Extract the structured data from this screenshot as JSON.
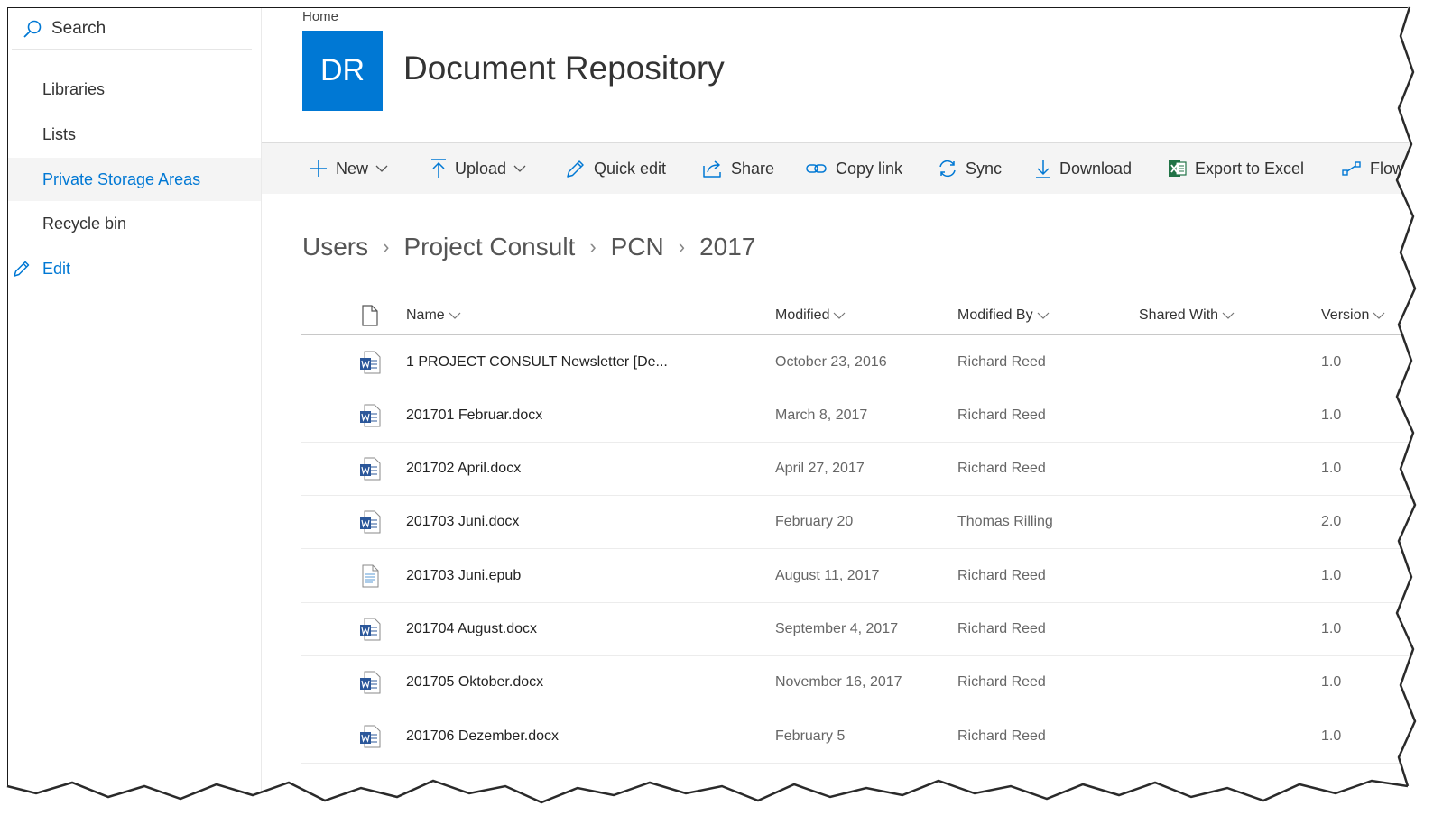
{
  "sidebar": {
    "search_label": "Search",
    "items": [
      {
        "label": "Libraries"
      },
      {
        "label": "Lists"
      },
      {
        "label": "Private Storage Areas"
      },
      {
        "label": "Recycle bin"
      }
    ],
    "edit_label": "Edit",
    "selected_item": "Private Storage Areas"
  },
  "header": {
    "home_link": "Home",
    "site_logo_text": "DR",
    "site_title": "Document Repository"
  },
  "toolbar": {
    "new": "New",
    "upload": "Upload",
    "quick_edit": "Quick edit",
    "share": "Share",
    "copy_link": "Copy link",
    "sync": "Sync",
    "download": "Download",
    "export_excel": "Export to Excel",
    "flow": "Flow"
  },
  "path": [
    "Users",
    "Project Consult",
    "PCN",
    "2017"
  ],
  "table": {
    "columns": {
      "name": "Name",
      "modified": "Modified",
      "modified_by": "Modified By",
      "shared_with": "Shared With",
      "version": "Version"
    },
    "rows": [
      {
        "name": "1 PROJECT CONSULT Newsletter [De...",
        "modified": "October 23, 2016",
        "modified_by": "Richard Reed",
        "version": "1.0",
        "icon": "word-doc-icon"
      },
      {
        "name": "201701 Februar.docx",
        "modified": "March 8, 2017",
        "modified_by": "Richard Reed",
        "version": "1.0",
        "icon": "word-doc-icon"
      },
      {
        "name": "201702 April.docx",
        "modified": "April 27, 2017",
        "modified_by": "Richard Reed",
        "version": "1.0",
        "icon": "word-doc-icon"
      },
      {
        "name": "201703 Juni.docx",
        "modified": "February 20",
        "modified_by": "Thomas Rilling",
        "version": "2.0",
        "icon": "word-doc-icon"
      },
      {
        "name": "201703 Juni.epub",
        "modified": "August 11, 2017",
        "modified_by": "Richard Reed",
        "version": "1.0",
        "icon": "generic-file-icon"
      },
      {
        "name": "201704 August.docx",
        "modified": "September 4, 2017",
        "modified_by": "Richard Reed",
        "version": "1.0",
        "icon": "word-doc-icon"
      },
      {
        "name": "201705 Oktober.docx",
        "modified": "November 16, 2017",
        "modified_by": "Richard Reed",
        "version": "1.0",
        "icon": "word-doc-icon"
      },
      {
        "name": "201706 Dezember.docx",
        "modified": "February 5",
        "modified_by": "Richard Reed",
        "version": "1.0",
        "icon": "word-doc-icon"
      }
    ]
  },
  "colors": {
    "accent": "#0078d4",
    "excel_green": "#217346",
    "word_blue": "#2b579a"
  }
}
